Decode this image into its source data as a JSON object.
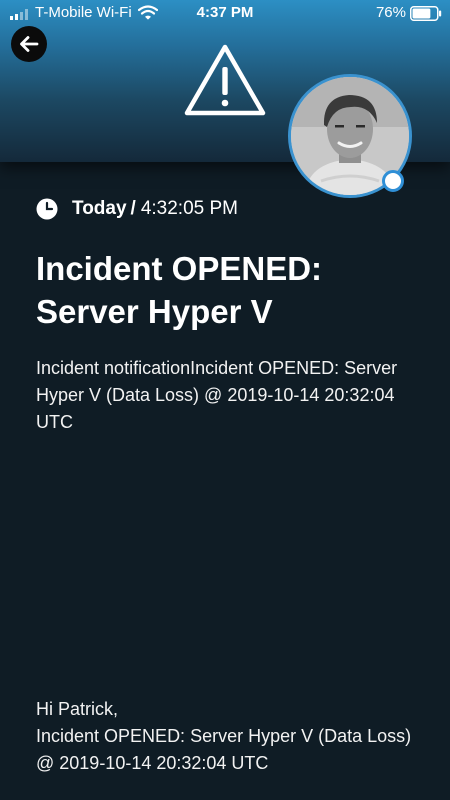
{
  "status_bar": {
    "carrier": "T-Mobile Wi-Fi",
    "time": "4:37 PM",
    "battery_percent": "76%",
    "battery_level": 0.76
  },
  "header": {
    "back_icon": "arrow-left-icon",
    "warning_icon": "warning-triangle-icon",
    "avatar_icon": "user-avatar",
    "gradient_top": "#2c8fc4",
    "gradient_bottom": "#14293a"
  },
  "incident": {
    "timestamp_day": "Today",
    "timestamp_separator": "/",
    "timestamp_time": "4:32:05 PM",
    "title": "Incident OPENED: Server Hyper V",
    "summary": "Incident notificationIncident OPENED: Server Hyper V (Data Loss) @ 2019-10-14 20:32:04 UTC",
    "message_greeting": "Hi Patrick,",
    "message_body": "Incident OPENED: Server Hyper V (Data Loss) @ 2019-10-14 20:32:04 UTC"
  },
  "colors": {
    "background": "#0f1c25",
    "accent": "#2f8fd6",
    "text": "#ffffff"
  }
}
